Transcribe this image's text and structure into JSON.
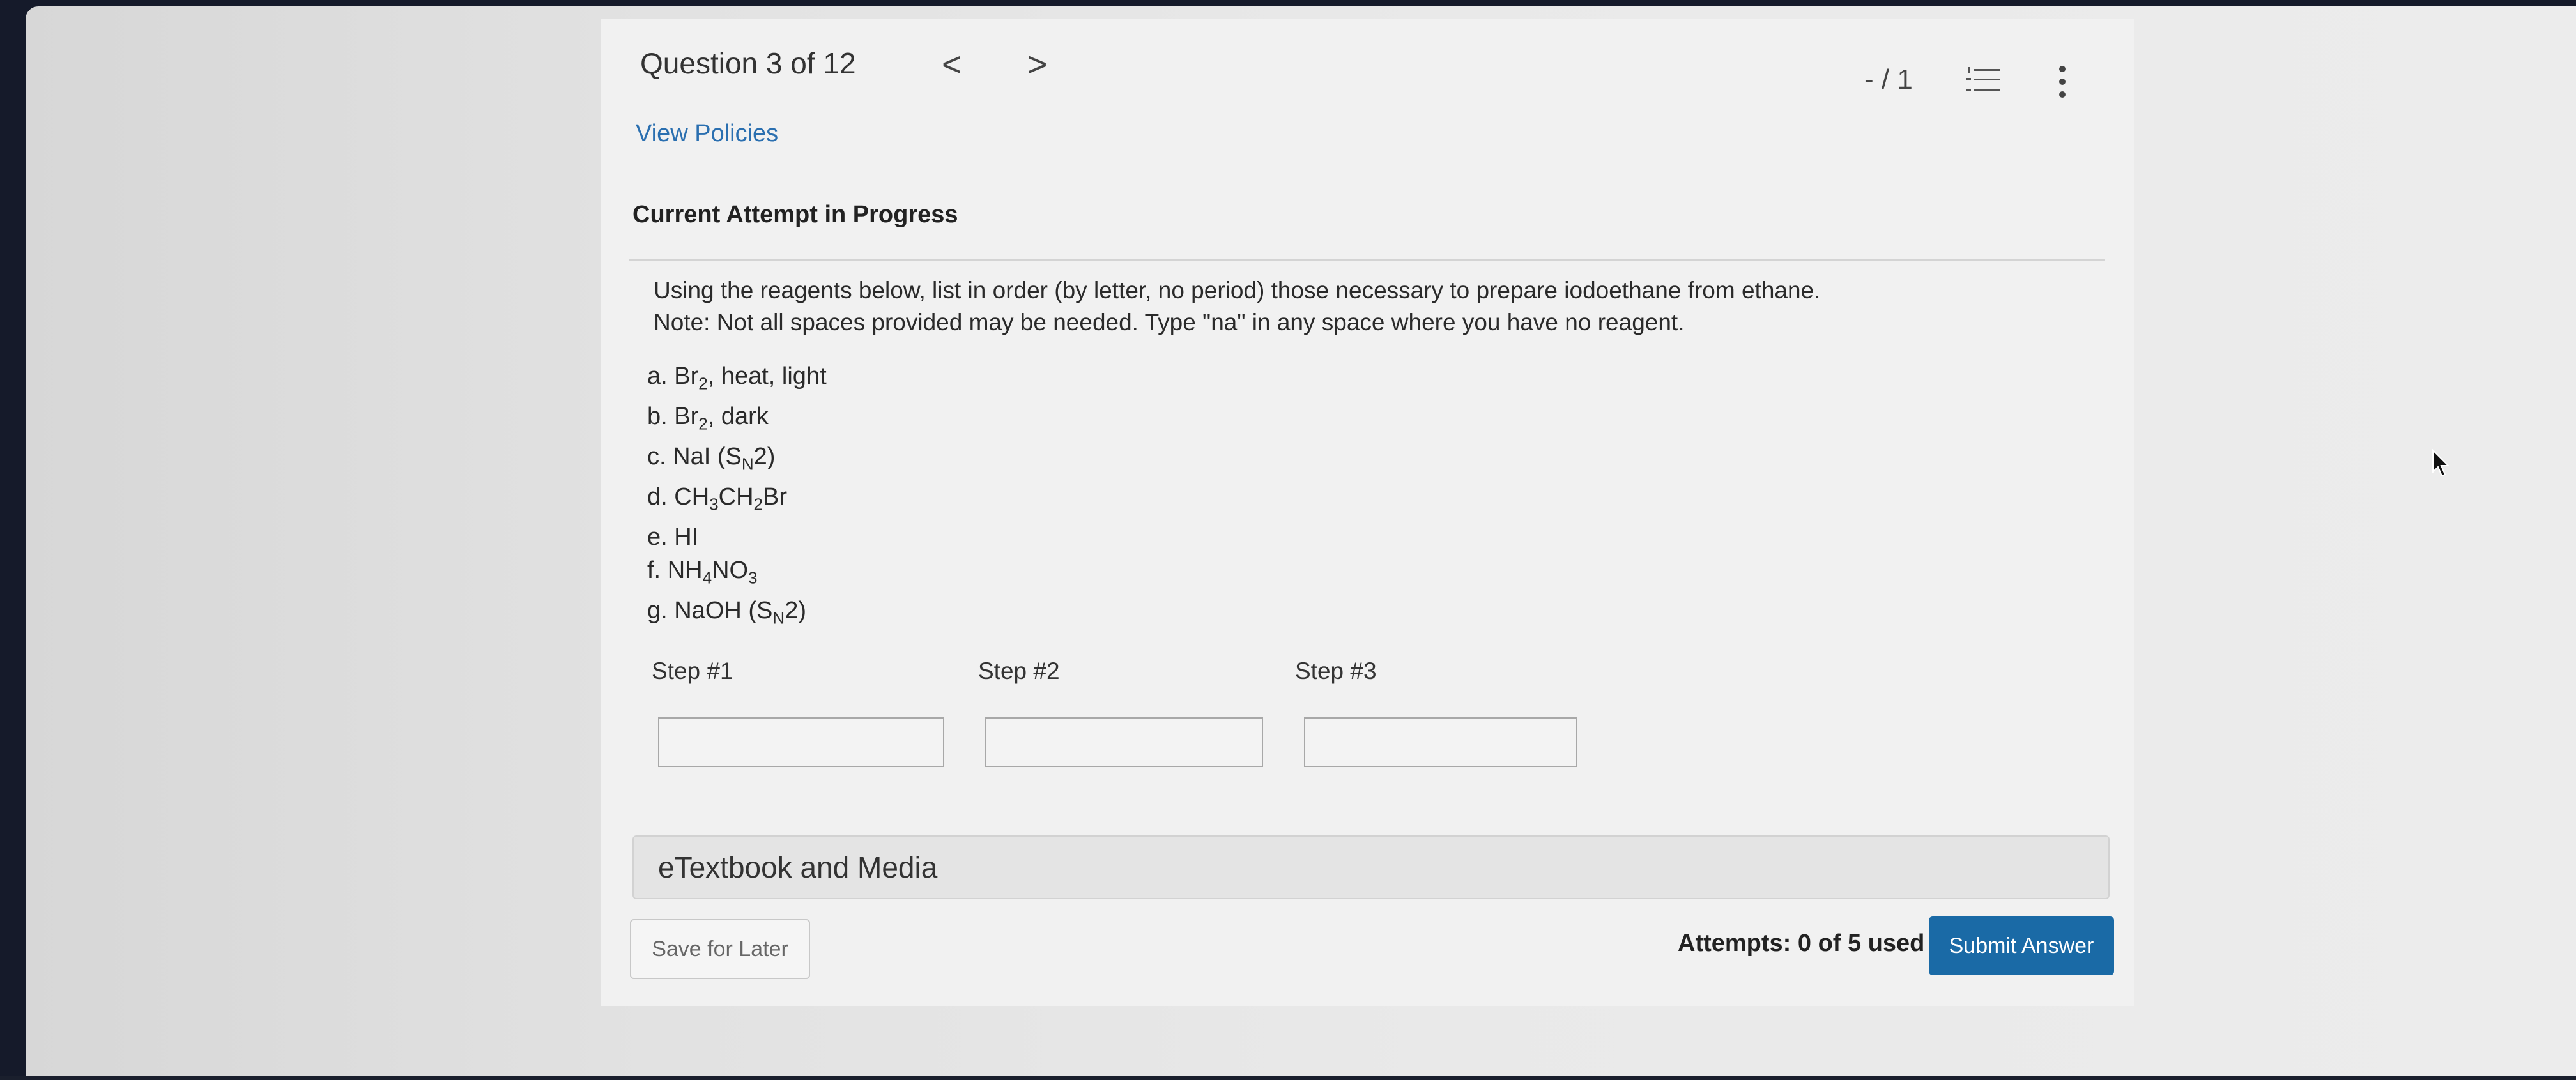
{
  "header": {
    "question_counter": "Question 3 of 12",
    "prev_glyph": "<",
    "next_glyph": ">",
    "score": "- / 1",
    "list_icon": "numbered-list-icon",
    "more_icon": "kebab-menu-icon"
  },
  "links": {
    "view_policies": "View Policies"
  },
  "attempt_heading": "Current Attempt in Progress",
  "question": {
    "line1": "Using the reagents below, list in order (by letter, no period) those necessary to prepare iodoethane from ethane.",
    "line2": "Note: Not all spaces provided may be needed. Type \"na\" in any space where you have no reagent."
  },
  "reagents": {
    "a": {
      "letter": "a.",
      "p1": "Br",
      "s1": "2",
      "p2": ", heat, light"
    },
    "b": {
      "letter": "b.",
      "p1": "Br",
      "s1": "2",
      "p2": ", dark"
    },
    "c": {
      "letter": "c.",
      "p1": "NaI (S",
      "s1": "N",
      "p2": "2)"
    },
    "d": {
      "letter": "d.",
      "p1": "CH",
      "s1": "3",
      "p2": "CH",
      "s2": "2",
      "p3": "Br"
    },
    "e": {
      "letter": "e.",
      "p1": "HI"
    },
    "f": {
      "letter": "f.",
      "p1": "NH",
      "s1": "4",
      "p2": "NO",
      "s2": "3"
    },
    "g": {
      "letter": "g.",
      "p1": "NaOH (S",
      "s1": "N",
      "p2": "2)"
    }
  },
  "steps": [
    {
      "label": "Step #1",
      "value": ""
    },
    {
      "label": "Step #2",
      "value": ""
    },
    {
      "label": "Step #3",
      "value": ""
    }
  ],
  "etextbook": "eTextbook and Media",
  "footer": {
    "save_label": "Save for Later",
    "attempts": "Attempts: 0 of 5 used",
    "submit_label": "Submit Answer"
  },
  "colors": {
    "accent": "#1a6aa6",
    "link": "#2a6fb0",
    "panel": "#f1f1f1"
  }
}
